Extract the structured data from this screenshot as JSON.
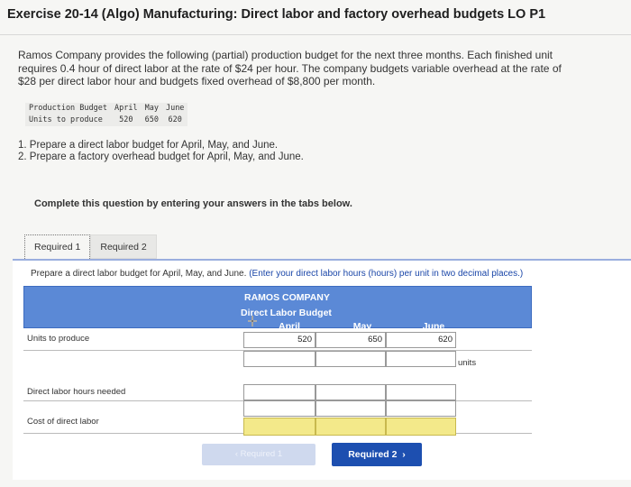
{
  "title": "Exercise 20-14 (Algo) Manufacturing: Direct labor and factory overhead budgets LO P1",
  "intro": [
    "Ramos Company provides the following (partial) production budget for the next three months. Each finished unit",
    "requires 0.4 hour of direct labor at the rate of $24 per hour. The company budgets variable overhead at the rate of",
    "$28 per direct labor hour and budgets fixed overhead of $8,800 per month."
  ],
  "production_budget": {
    "header_label": "Production Budget",
    "row_label": "Units to produce",
    "months": [
      "April",
      "May",
      "June"
    ],
    "values": [
      "520",
      "650",
      "620"
    ]
  },
  "tasks": [
    "1. Prepare a direct labor budget for April, May, and June.",
    "2. Prepare a factory overhead budget for April, May, and June."
  ],
  "complete_text": "Complete this question by entering your answers in the tabs below.",
  "tabs": [
    "Required 1",
    "Required 2"
  ],
  "instruction": {
    "main": "Prepare a direct labor budget for April, May, and June.",
    "note": "(Enter your direct labor hours (hours) per unit in two decimal places.)"
  },
  "budget": {
    "company": "RAMOS COMPANY",
    "title": "Direct Labor Budget",
    "columns": [
      "April",
      "May",
      "June"
    ],
    "rows": [
      {
        "label": "Units to produce",
        "values": [
          "520",
          "650",
          "620"
        ],
        "suffix": "units"
      },
      {
        "label": "Direct labor hours needed",
        "values": [
          "",
          "",
          ""
        ]
      },
      {
        "label": "Cost of direct labor",
        "values": [
          "",
          "",
          ""
        ]
      }
    ]
  },
  "nav": {
    "prev": "Required 1",
    "next": "Required 2"
  },
  "colors": {
    "header_blue": "#5b89d6",
    "button_blue": "#1d4fb0",
    "answer_yellow": "#f3e98a"
  }
}
